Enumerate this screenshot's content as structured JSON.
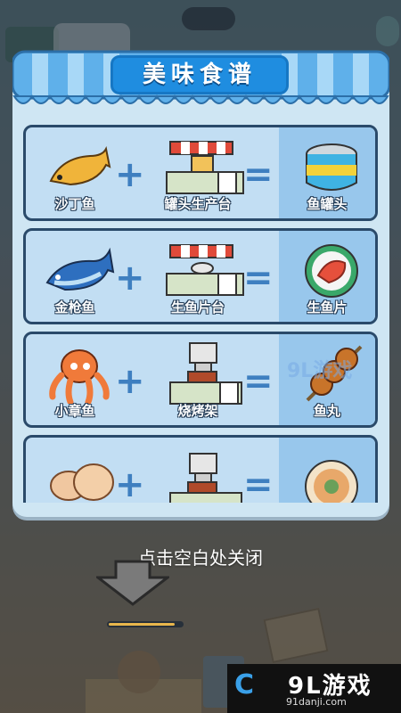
{
  "title": "美味食谱",
  "recipes": [
    {
      "ingredient": "沙丁鱼",
      "station": "罐头生产台",
      "result": "鱼罐头"
    },
    {
      "ingredient": "金枪鱼",
      "station": "生鱼片台",
      "result": "生鱼片"
    },
    {
      "ingredient": "小章鱼",
      "station": "烧烤架",
      "result": "鱼丸"
    },
    {
      "ingredient": "",
      "station": "",
      "result": ""
    }
  ],
  "plus_symbol": "+",
  "equals_symbol": "=",
  "hint": "点击空白处关闭",
  "progress": 0.9,
  "watermark": {
    "logo": "9L游戏",
    "site": "91danji.com",
    "center": "9L游戏"
  },
  "colors": {
    "title_bg": "#1f8de0",
    "card_bg": "#c2def3",
    "result_bg": "#98c7ec",
    "panel_bg": "#cfe6f3"
  }
}
